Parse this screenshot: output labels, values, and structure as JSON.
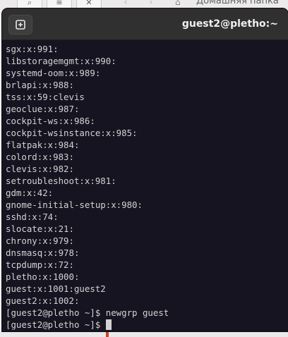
{
  "background": {
    "folder_label": "Домашняя папка",
    "buttons": [
      "search-icon",
      "menu-icon",
      "close-icon"
    ],
    "nav": [
      "back-icon",
      "forward-icon"
    ]
  },
  "terminal": {
    "title": "guest2@pletho:~",
    "new_tab_icon": "new-tab-icon",
    "lines": [
      "sgx:x:991:",
      "libstoragemgmt:x:990:",
      "systemd-oom:x:989:",
      "brlapi:x:988:",
      "tss:x:59:clevis",
      "geoclue:x:987:",
      "cockpit-ws:x:986:",
      "cockpit-wsinstance:x:985:",
      "flatpak:x:984:",
      "colord:x:983:",
      "clevis:x:982:",
      "setroubleshoot:x:981:",
      "gdm:x:42:",
      "gnome-initial-setup:x:980:",
      "sshd:x:74:",
      "slocate:x:21:",
      "chrony:x:979:",
      "dnsmasq:x:978:",
      "tcpdump:x:72:",
      "pletho:x:1000:",
      "guest:x:1001:guest2",
      "guest2:x:1002:",
      "[guest2@pletho ~]$ newgrp guest"
    ],
    "prompt": "[guest2@pletho ~]$ "
  },
  "colors": {
    "terminal_bg": "#171421",
    "headerbar_bg": "#303030",
    "text": "#d2d2d2"
  }
}
